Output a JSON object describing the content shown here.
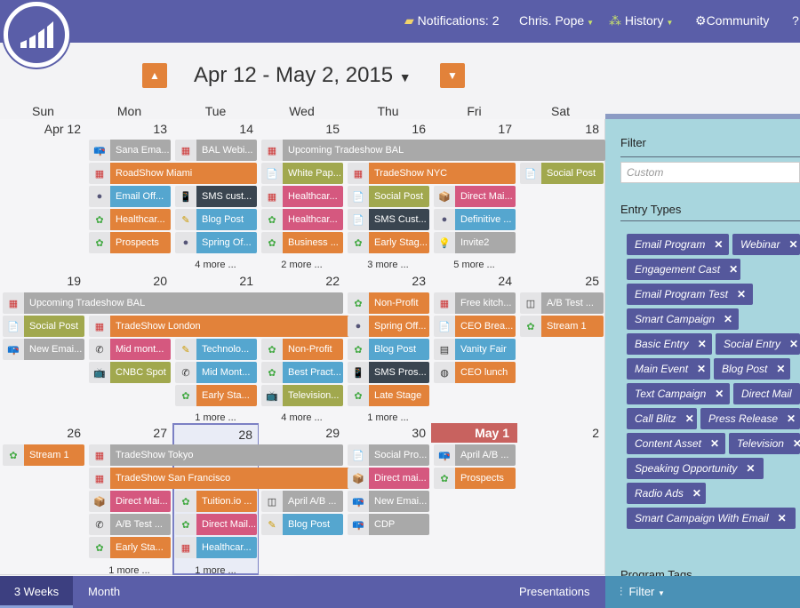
{
  "header": {
    "notifications": "Notifications: 2",
    "user": "Chris. Pope",
    "history": "History",
    "community": "Community"
  },
  "date_range": "Apr 12 - May 2, 2015",
  "weekdays": [
    "Sun",
    "Mon",
    "Tue",
    "Wed",
    "Thu",
    "Fri",
    "Sat"
  ],
  "weeks": [
    {
      "days": [
        "Apr 12",
        "13",
        "14",
        "15",
        "16",
        "17",
        "18"
      ],
      "more": [
        "",
        "",
        "4 more ...",
        "2 more ...",
        "3 more ...",
        "5 more ...",
        ""
      ],
      "span1": "Upcoming Tradeshow BAL",
      "events": {
        "mon": [
          "Sana Ema...",
          "RoadShow Miami",
          "Email Off...",
          "Healthcar...",
          "Prospects"
        ],
        "tue": [
          "BAL Webi...",
          "SMS cust...",
          "Blog Post",
          "Spring Of..."
        ],
        "wed": [
          "White Pap...",
          "Healthcar...",
          "Healthcar...",
          "Business ..."
        ],
        "thu": [
          "TradeShow NYC",
          "Social Post",
          "SMS Cust...",
          "Early Stag..."
        ],
        "fri": [
          "Direct Mai...",
          "Definitive ...",
          "Invite2"
        ],
        "sat": [
          "Social Post"
        ]
      }
    },
    {
      "days": [
        "19",
        "20",
        "21",
        "22",
        "23",
        "24",
        "25"
      ],
      "more": [
        "",
        "",
        "1 more ...",
        "4 more ...",
        "1 more ...",
        "",
        ""
      ],
      "span1": "Upcoming Tradeshow BAL",
      "span2": "TradeShow London",
      "events": {
        "sun": [
          "Social Post",
          "New Emai..."
        ],
        "mon": [
          "Mid mont...",
          "CNBC Spot"
        ],
        "tue": [
          "Technolo...",
          "Mid Mont...",
          "Early Sta..."
        ],
        "wed": [
          "Non-Profit",
          "Best Pract...",
          "Television..."
        ],
        "thu": [
          "Non-Profit",
          "Spring Off...",
          "Blog Post",
          "SMS Pros...",
          "Late Stage"
        ],
        "fri": [
          "Free kitch...",
          "CEO Brea...",
          "Vanity Fair",
          "CEO lunch"
        ],
        "sat": [
          "A/B Test ...",
          "Stream 1"
        ]
      }
    },
    {
      "days": [
        "26",
        "27",
        "28",
        "29",
        "30",
        "May 1",
        "2"
      ],
      "more": [
        "",
        "",
        "1 more ...",
        "1 more ...",
        "",
        "",
        ""
      ],
      "span1": "TradeShow Tokyo",
      "span2": "TradeShow San Francisco",
      "events": {
        "sun": [
          "Stream 1"
        ],
        "mon": [
          "Direct Mai...",
          "A/B Test ...",
          "Early Sta..."
        ],
        "tue": [
          "Tuition.io ...",
          "Direct Mail...",
          "Healthcar..."
        ],
        "wed": [
          "April A/B ...",
          "Blog Post"
        ],
        "thu": [
          "Social Pro...",
          "Direct mai...",
          "New Emai...",
          "CDP"
        ],
        "fri": [
          "April A/B ...",
          "Prospects"
        ]
      }
    }
  ],
  "sidebar": {
    "filter_title": "Filter",
    "filter_placeholder": "Custom",
    "entry_types_title": "Entry Types",
    "tags": [
      "Email Program",
      "Webinar",
      "Engagement Cast",
      "Email Program Test",
      "Smart Campaign",
      "Basic Entry",
      "Social Entry",
      "Main Event",
      "Blog Post",
      "Text Campaign",
      "Direct Mail",
      "Call Blitz",
      "Press Release",
      "Content Asset",
      "Television",
      "Speaking Opportunity",
      "Radio Ads",
      "Smart Campaign With Email"
    ],
    "program_tags_title": "Program Tags"
  },
  "bottom": {
    "tab_3weeks": "3 Weeks",
    "tab_month": "Month",
    "presentations": "Presentations",
    "filter": "Filter"
  },
  "colors": {
    "header": "#5a5ea8",
    "orange": "#e2823a",
    "gray": "#a9a9a9",
    "green": "#a1a84e",
    "blue": "#55a6cf",
    "pink": "#d5587f",
    "dark": "#3a4550",
    "tag": "#55589c",
    "sidebar": "#a8d6de",
    "today_header": "#c8625f"
  }
}
